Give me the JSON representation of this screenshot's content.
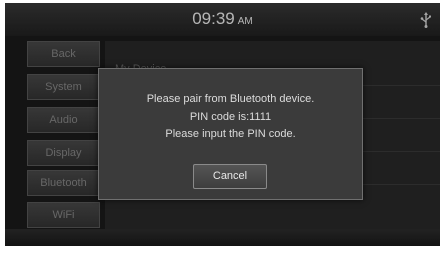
{
  "status": {
    "time": "09:39",
    "ampm": "AM",
    "usb_icon": "usb-icon"
  },
  "sidebar": {
    "items": [
      {
        "label": "Back"
      },
      {
        "label": "System"
      },
      {
        "label": "Audio"
      },
      {
        "label": "Display"
      },
      {
        "label": "Bluetooth"
      },
      {
        "label": "WiFi"
      }
    ]
  },
  "content": {
    "rows": [
      {
        "label": "My Device"
      }
    ]
  },
  "dialog": {
    "line1": "Please pair from Bluetooth device.",
    "line2": "PIN code is:1111",
    "line3": "Please input the PIN code.",
    "cancel_label": "Cancel"
  }
}
